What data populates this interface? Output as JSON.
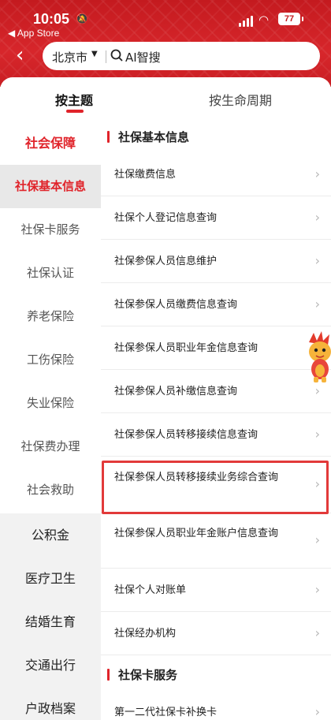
{
  "status": {
    "time": "10:05",
    "back_app": "◀ App Store",
    "battery": "77"
  },
  "search": {
    "city": "北京市",
    "query": "AI智搜"
  },
  "tabs": [
    {
      "label": "按主题"
    },
    {
      "label": "按生命周期"
    }
  ],
  "sidebar": {
    "category_active": "社会保障",
    "subitems": [
      "社保基本信息",
      "社保卡服务",
      "社保认证",
      "养老保险",
      "工伤保险",
      "失业保险",
      "社保费办理",
      "社会救助"
    ],
    "active_subitem": "社保基本信息",
    "categories": [
      "公积金",
      "医疗卫生",
      "结婚生育",
      "交通出行",
      "户政档案"
    ]
  },
  "sections": [
    {
      "title": "社保基本信息",
      "items": [
        "社保缴费信息",
        "社保个人登记信息查询",
        "社保参保人员信息维护",
        "社保参保人员缴费信息查询",
        "社保参保人员职业年金信息查询",
        "社保参保人员补缴信息查询",
        "社保参保人员转移接续信息查询",
        "社保参保人员转移接续业务综合查询",
        "社保参保人员职业年金账户信息查询",
        "社保个人对账单",
        "社保经办机构"
      ]
    },
    {
      "title": "社保卡服务",
      "items": [
        "第一二代社保卡补换卡"
      ]
    }
  ],
  "colors": {
    "brand_red": "#d7262b",
    "accent": "#e0232a",
    "highlight": "#e23a3a"
  }
}
